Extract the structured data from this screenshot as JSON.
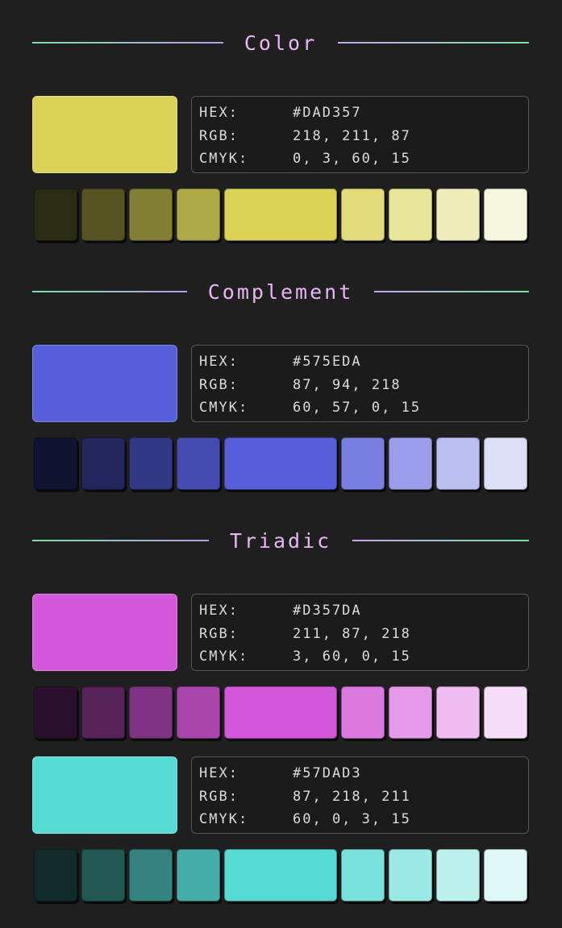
{
  "sections": {
    "color": {
      "title": "Color"
    },
    "complement": {
      "title": "Complement"
    },
    "triadic": {
      "title": "Triadic"
    }
  },
  "labels": {
    "hex": "HEX:",
    "rgb": "RGB:",
    "cmyk": "CMYK:"
  },
  "colors": [
    {
      "hex": "#DAD357",
      "rgb": "218, 211, 87",
      "cmyk": "0, 3, 60, 15",
      "swatch": "#DAD357",
      "shades": [
        "#2b2a12",
        "#575424",
        "#827e35",
        "#ada947",
        "#DAD357",
        "#e1dc79",
        "#e9e59a",
        "#f0edbc",
        "#f7f6de"
      ]
    },
    {
      "hex": "#575EDA",
      "rgb": "87, 94, 218",
      "cmyk": "60, 57, 0, 15",
      "swatch": "#575EDA",
      "shades": [
        "#111330",
        "#23265a",
        "#333882",
        "#444ab0",
        "#575EDA",
        "#797ee1",
        "#9a9ee9",
        "#bbbff0",
        "#dddff8"
      ]
    },
    {
      "hex": "#D357DA",
      "rgb": "211, 87, 218",
      "cmyk": "3, 60, 0, 15",
      "swatch": "#D357DA",
      "shades": [
        "#2a112b",
        "#542357",
        "#7f3483",
        "#a946ae",
        "#D357DA",
        "#dc79e1",
        "#e59ae9",
        "#edbcf0",
        "#f6ddf8"
      ]
    },
    {
      "hex": "#57DAD3",
      "rgb": "87, 218, 211",
      "cmyk": "60, 0, 3, 15",
      "swatch": "#57DAD3",
      "shades": [
        "#112b2a",
        "#235754",
        "#34837f",
        "#46aea9",
        "#57DAD3",
        "#79e1dc",
        "#9ae9e5",
        "#bcf0ed",
        "#ddf8f6"
      ]
    }
  ]
}
